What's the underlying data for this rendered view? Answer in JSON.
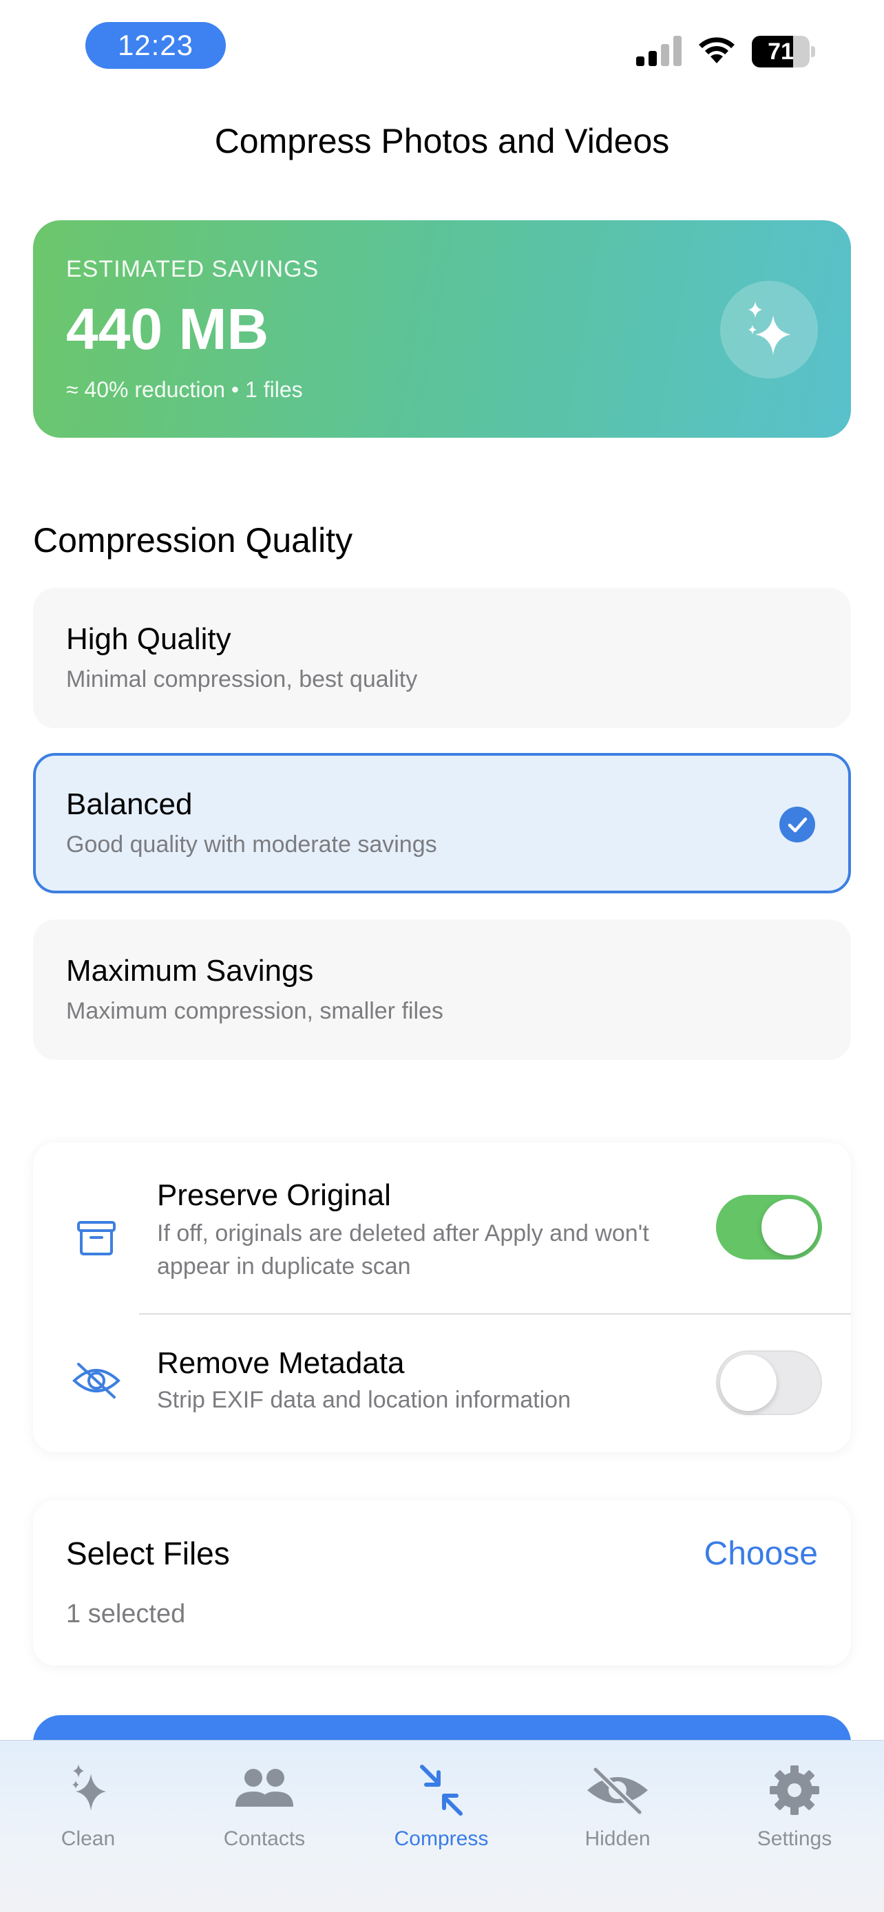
{
  "status_bar": {
    "time": "12:23",
    "battery_level": "71",
    "battery_fraction": 0.71
  },
  "header": {
    "title": "Compress Photos and Videos"
  },
  "savings": {
    "label": "ESTIMATED SAVINGS",
    "value": "440 MB",
    "detail": "≈ 40% reduction • 1 files",
    "icon": "sparkles-icon"
  },
  "quality": {
    "section_title": "Compression Quality",
    "options": [
      {
        "title": "High Quality",
        "subtitle": "Minimal compression, best quality",
        "selected": false
      },
      {
        "title": "Balanced",
        "subtitle": "Good quality with moderate savings",
        "selected": true
      },
      {
        "title": "Maximum Savings",
        "subtitle": "Maximum compression, smaller files",
        "selected": false
      }
    ]
  },
  "settings": {
    "preserve_original": {
      "title": "Preserve Original",
      "description": "If off, originals are deleted after Apply and won't appear in duplicate scan",
      "enabled": true,
      "icon": "archive-box-icon"
    },
    "remove_metadata": {
      "title": "Remove Metadata",
      "description": "Strip EXIF data and location information",
      "enabled": false,
      "icon": "eye-slash-icon"
    }
  },
  "files": {
    "title": "Select Files",
    "action": "Choose",
    "count_text": "1 selected"
  },
  "tab_bar": {
    "tabs": [
      {
        "label": "Clean",
        "icon": "sparkles-icon",
        "active": false
      },
      {
        "label": "Contacts",
        "icon": "people-icon",
        "active": false
      },
      {
        "label": "Compress",
        "icon": "compress-arrows-icon",
        "active": true
      },
      {
        "label": "Hidden",
        "icon": "eye-slash-icon",
        "active": false
      },
      {
        "label": "Settings",
        "icon": "gear-icon",
        "active": false
      }
    ]
  },
  "colors": {
    "accent": "#3d82f0",
    "toggle_on": "#64c466",
    "tab_inactive": "#8a919a"
  }
}
